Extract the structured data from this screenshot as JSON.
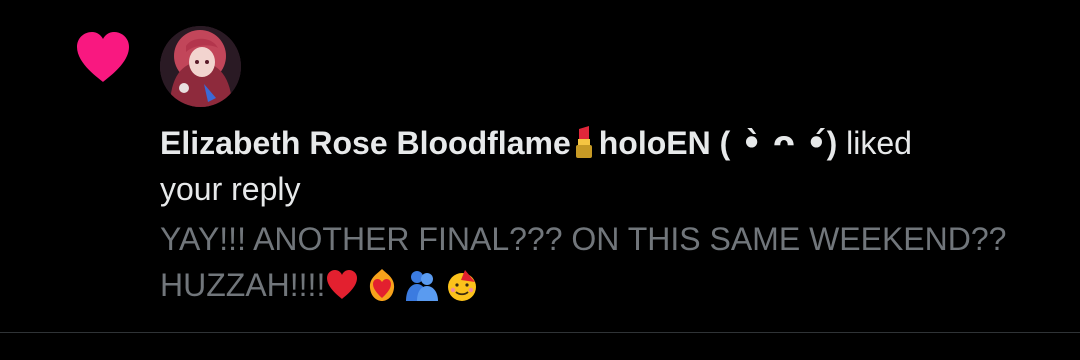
{
  "notification": {
    "type_icon": "heart-icon",
    "accent_color": "#f91880",
    "avatar_icon": "user-avatar",
    "actor_name": "Elizabeth Rose Bloodflame",
    "actor_name_emoji": "lipstick-emoji",
    "actor_name_suffix": "holoEN (",
    "actor_kaomoji": " •̀ ᴖ •́",
    "actor_name_end": ")",
    "action_text": " liked",
    "action_text_2": "your reply",
    "reply": {
      "text": "YAY!!! ANOTHER FINAL??? ON THIS SAME WEEKEND?? HUZZAH!!!!",
      "emojis": [
        "red-heart-emoji",
        "heart-on-fire-emoji",
        "people-hugging-emoji",
        "partying-face-emoji"
      ],
      "text_color": "#71767b"
    }
  }
}
